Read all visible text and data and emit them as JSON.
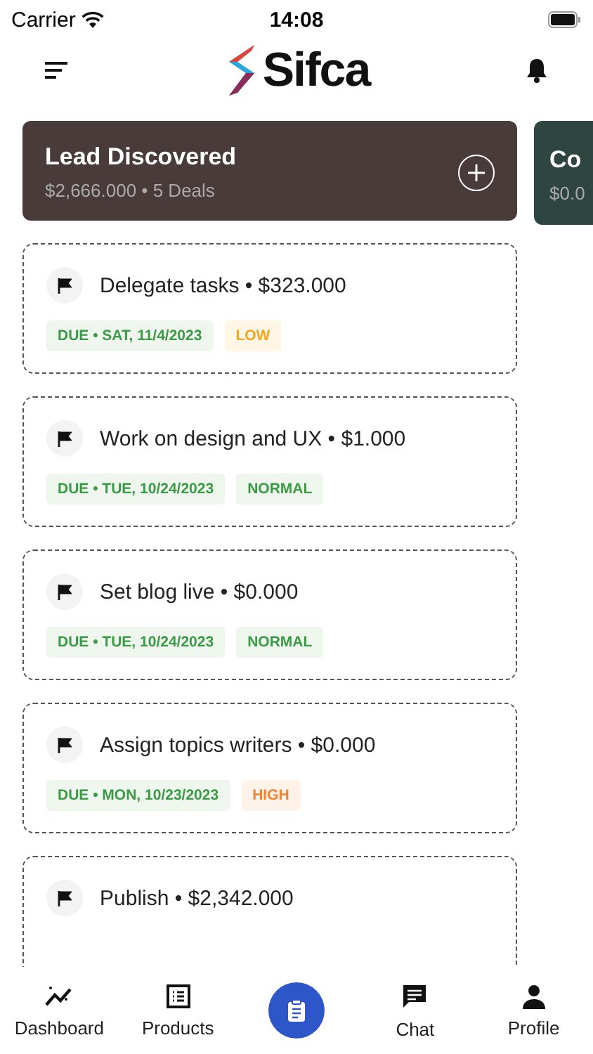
{
  "status_bar": {
    "carrier": "Carrier",
    "time": "14:08"
  },
  "header": {
    "logo_text": "Sifca"
  },
  "columns": [
    {
      "title": "Lead Discovered",
      "summary": "$2,666.000 • 5 Deals",
      "color": "#4a3b3b",
      "cards": [
        {
          "title": "Delegate tasks • $323.000",
          "due": "DUE • SAT, 11/4/2023",
          "priority": {
            "label": "LOW",
            "kind": "low"
          }
        },
        {
          "title": "Work on design and UX • $1.000",
          "due": "DUE • TUE, 10/24/2023",
          "priority": {
            "label": "NORMAL",
            "kind": "normal"
          }
        },
        {
          "title": "Set blog live • $0.000",
          "due": "DUE • TUE, 10/24/2023",
          "priority": {
            "label": "NORMAL",
            "kind": "normal"
          }
        },
        {
          "title": "Assign topics writers • $0.000",
          "due": "DUE • MON, 10/23/2023",
          "priority": {
            "label": "HIGH",
            "kind": "high"
          }
        },
        {
          "title": "Publish • $2,342.000"
        }
      ]
    },
    {
      "title": "Co",
      "summary": "$0.0",
      "color": "#2f4540"
    }
  ],
  "tab_bar": [
    {
      "label": "Dashboard",
      "kind": "dashboard"
    },
    {
      "label": "Products",
      "kind": "products"
    },
    {
      "kind": "center"
    },
    {
      "label": "Chat",
      "kind": "chat"
    },
    {
      "label": "Profile",
      "kind": "profile"
    }
  ]
}
